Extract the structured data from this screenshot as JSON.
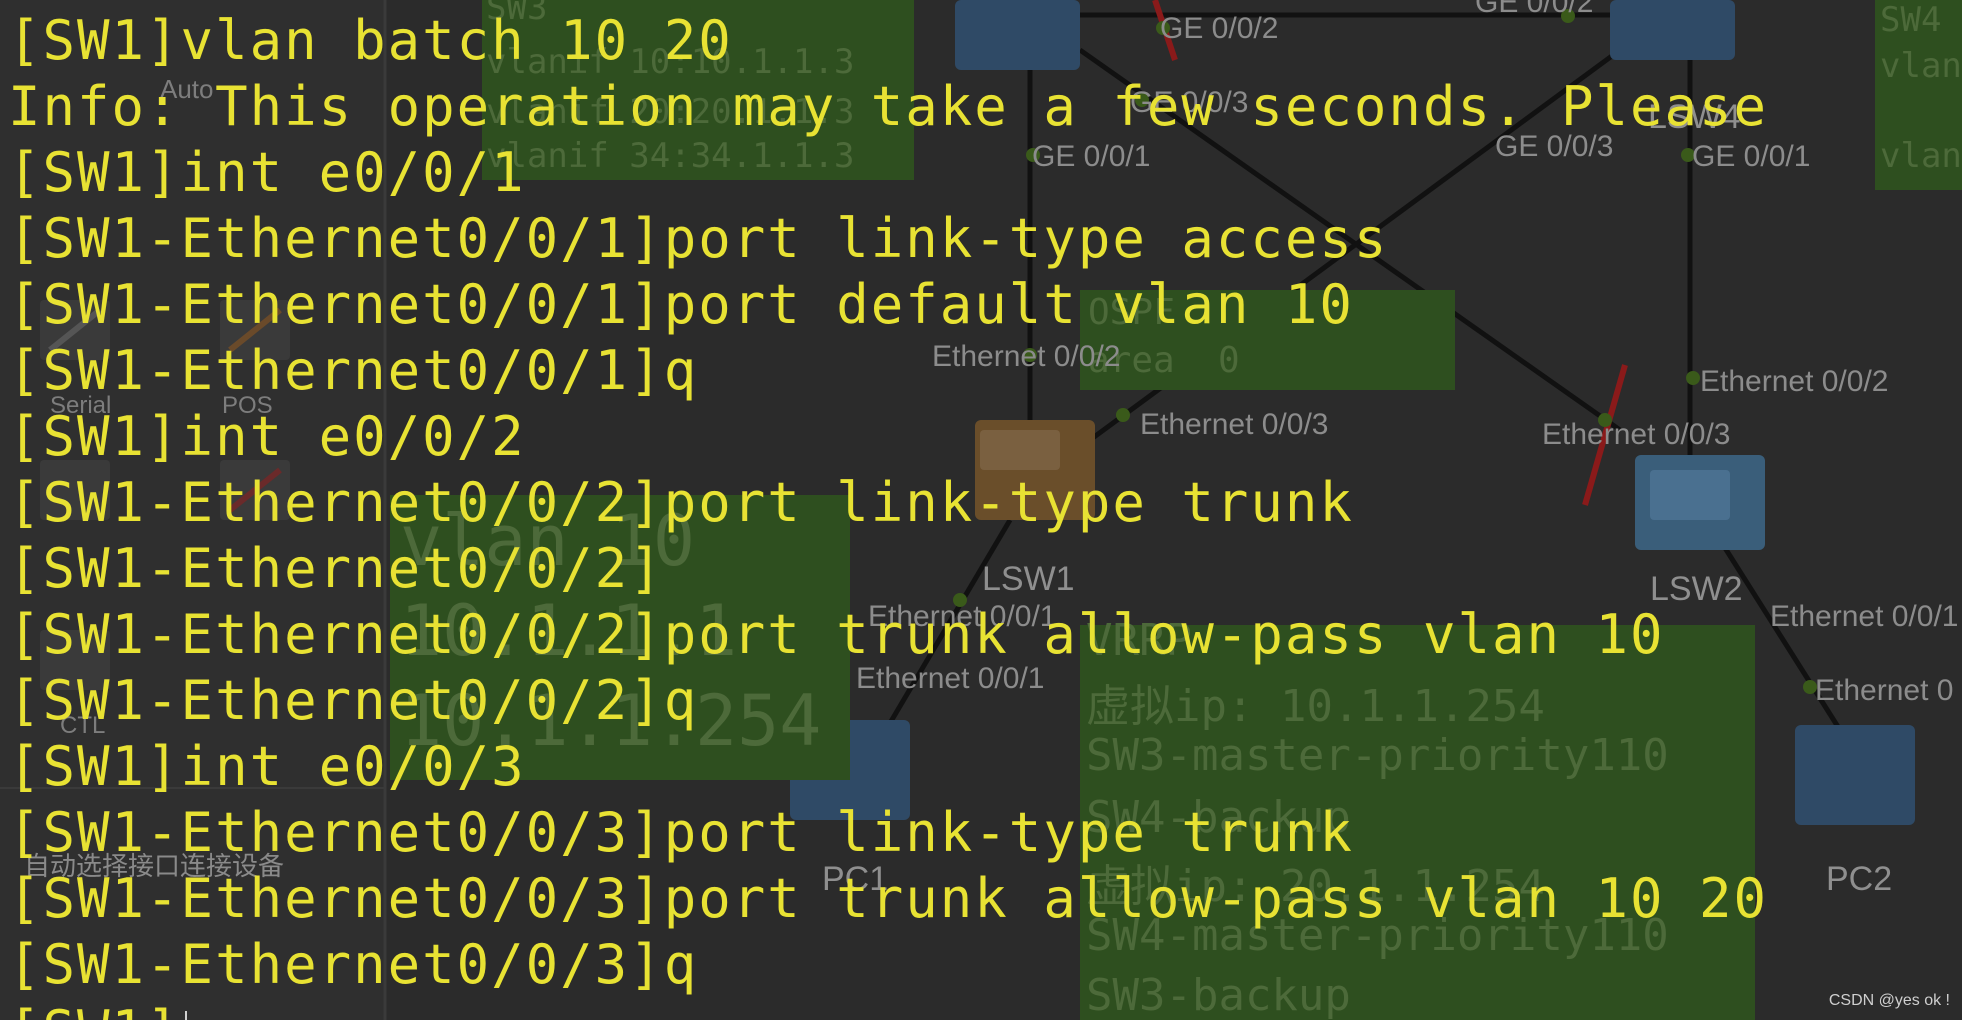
{
  "toolbar": {
    "labels": [
      "Auto",
      "Serial",
      "POS",
      "CTL"
    ]
  },
  "hint_text": "自动选择接口连接设备",
  "topology": {
    "device_labels": [
      "LSW1",
      "LSW2",
      "LSW4",
      "PC1",
      "PC2",
      "SW3",
      "SW4"
    ],
    "port_labels": [
      "GE 0/0/2",
      "GE 0/0/3",
      "GE 0/0/1",
      "GE 0/0/3",
      "GE 0/0/1",
      "GE 0/0/2",
      "Ethernet 0/0/2",
      "Ethernet 0/0/3",
      "Ethernet 0/0/3",
      "Ethernet 0/0/2",
      "Ethernet 0/0/1",
      "Ethernet 0/0/1",
      "Ethernet 0/0/1",
      "Ethernet 0"
    ],
    "ospf_note": [
      "OSPF",
      "area  0"
    ],
    "sw3_note": [
      "SW3",
      "vlanif 10:10.1.1.3",
      "vlanif 20:20.1.1.3",
      "vlanif 34:34.1.1.3"
    ],
    "sw4_note": [
      "SW4",
      "vlan",
      "vlan"
    ],
    "vlan10_note": [
      "vlan 10",
      "10.1.1.1",
      "10.1.1.254"
    ],
    "vrrp_note": [
      "VRRP",
      "虚拟ip: 10.1.1.254",
      "SW3-master-priority110",
      "SW4-backup",
      "虚拟ip: 20.1.1.254",
      "SW4-master-priority110",
      "SW3-backup"
    ]
  },
  "terminal": {
    "lines": [
      "[SW1]vlan batch 10 20",
      "Info: This operation may take a few seconds. Please",
      "[SW1]int e0/0/1",
      "[SW1-Ethernet0/0/1]port link-type access",
      "[SW1-Ethernet0/0/1]port default vlan 10",
      "[SW1-Ethernet0/0/1]q",
      "[SW1]int e0/0/2",
      "[SW1-Ethernet0/0/2]port link-type trunk",
      "[SW1-Ethernet0/0/2]",
      "[SW1-Ethernet0/0/2]port trunk allow-pass vlan 10",
      "[SW1-Ethernet0/0/2]q",
      "[SW1]int e0/0/3",
      "[SW1-Ethernet0/0/3]port link-type trunk",
      "[SW1-Ethernet0/0/3]port trunk allow-pass vlan 10 20",
      "[SW1-Ethernet0/0/3]q",
      "[SW1]"
    ]
  },
  "watermark": "CSDN @yes  ok !",
  "colors": {
    "terminal_text": "#e8e233",
    "background": "#2b2b2b",
    "note_green": "#2e4f1f"
  }
}
